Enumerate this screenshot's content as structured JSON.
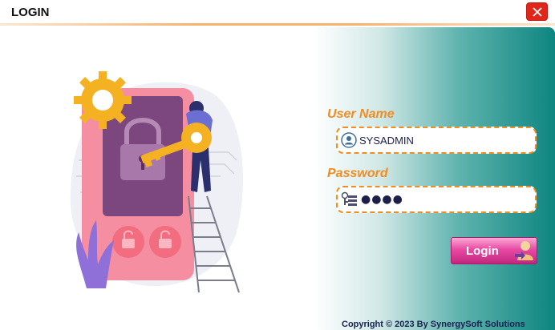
{
  "window": {
    "title": "LOGIN",
    "close_icon": "close-icon"
  },
  "form": {
    "username_label": "User Name",
    "username_value": "SYSADMIN",
    "username_icon": "user-icon",
    "password_label": "Password",
    "password_value": "●●●●",
    "password_icon": "key-icon",
    "login_label": "Login",
    "login_icon": "user-login-icon"
  },
  "footer": {
    "copyright": "Copyright © 2023 By SynergySoft Solutions"
  },
  "colors": {
    "accent": "#f28c1e",
    "teal": "#0e8580",
    "close": "#e0251b",
    "button": "#e84aa3"
  }
}
